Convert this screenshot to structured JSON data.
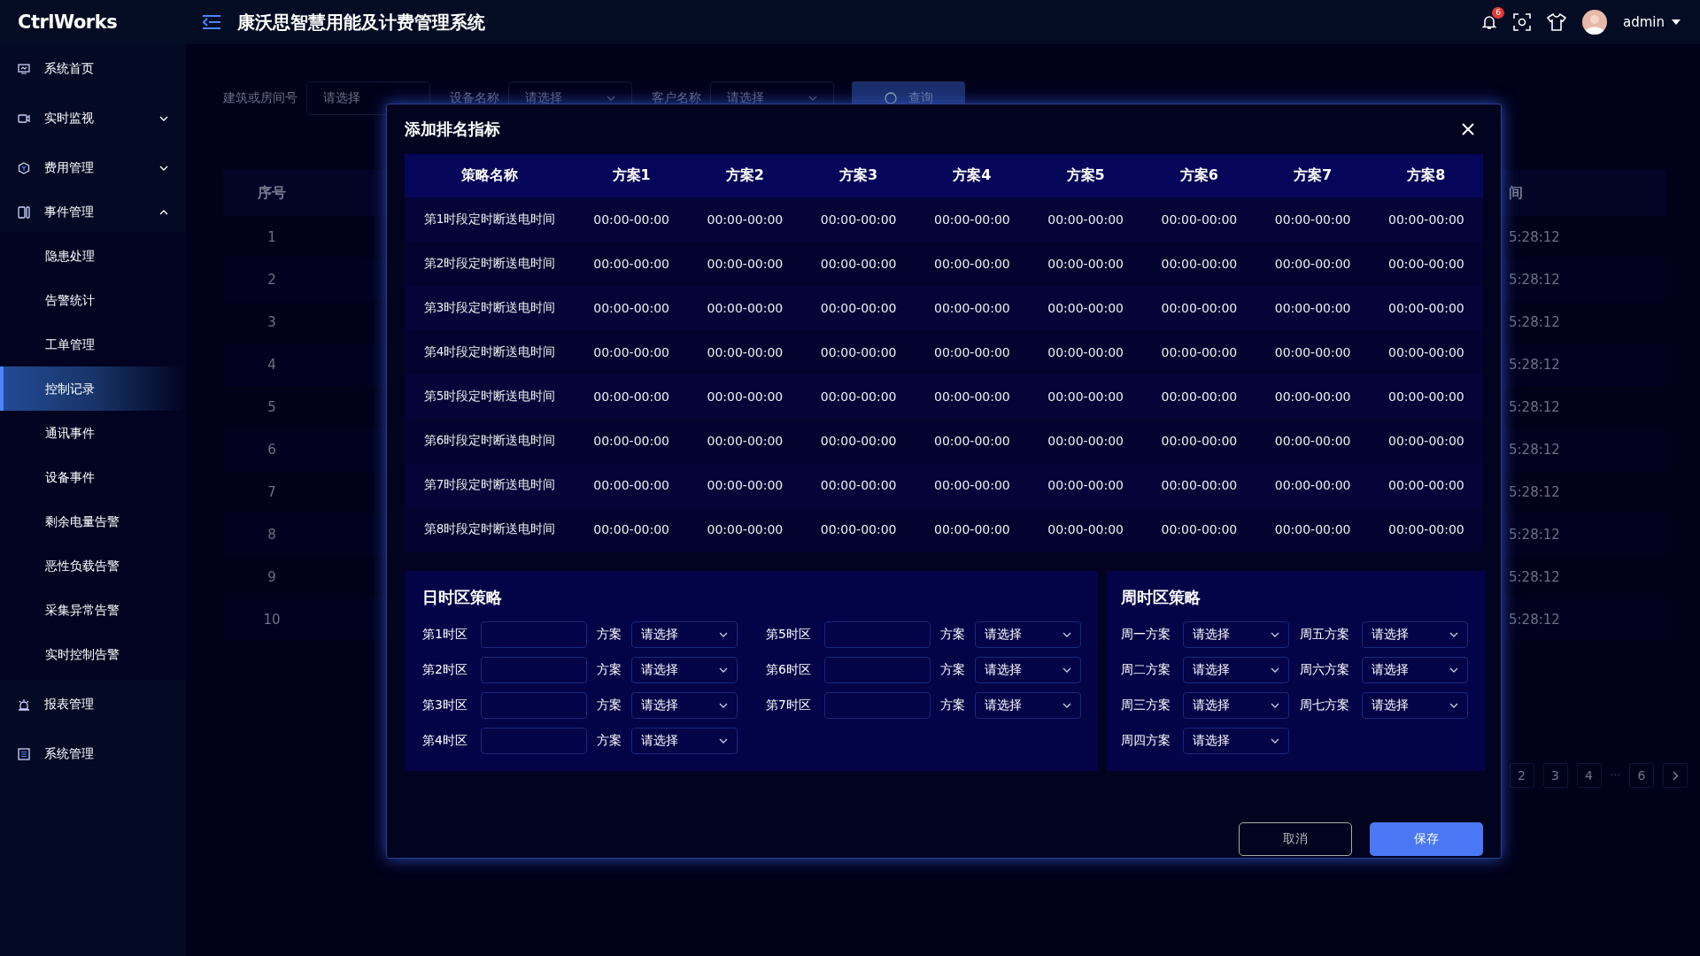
{
  "app": {
    "logo": "CtrlWorks",
    "title": "康沃思智慧用能及计费管理系统",
    "notification_count": "6",
    "user": "admin"
  },
  "sidebar": {
    "items": [
      {
        "label": "系统首页",
        "selected": false
      },
      {
        "label": "实时监视",
        "selected": false,
        "expanded": false
      },
      {
        "label": "费用管理",
        "selected": false,
        "expanded": false
      },
      {
        "label": "事件管理",
        "selected": false,
        "expanded": true,
        "children": [
          {
            "label": "隐患处理",
            "selected": false
          },
          {
            "label": "告警统计",
            "selected": false
          },
          {
            "label": "工单管理",
            "selected": false
          },
          {
            "label": "控制记录",
            "selected": true
          },
          {
            "label": "通讯事件",
            "selected": false
          },
          {
            "label": "设备事件",
            "selected": false
          },
          {
            "label": "剩余电量告警",
            "selected": false
          },
          {
            "label": "恶性负载告警",
            "selected": false
          },
          {
            "label": "采集异常告警",
            "selected": false
          },
          {
            "label": "实时控制告警",
            "selected": false
          }
        ]
      },
      {
        "label": "报表管理",
        "selected": false
      },
      {
        "label": "系统管理",
        "selected": false
      }
    ]
  },
  "filters": [
    {
      "label": "建筑或房间号",
      "placeholder": "请选择",
      "kind": "input"
    },
    {
      "label": "设备名称",
      "placeholder": "请选择",
      "kind": "select"
    },
    {
      "label": "客户名称",
      "placeholder": "请选择",
      "kind": "select"
    }
  ],
  "search_button": "查询",
  "table": {
    "columns": [
      "序号",
      "间"
    ],
    "rows": [
      {
        "index": "1",
        "time": "5:28:12"
      },
      {
        "index": "2",
        "time": "5:28:12"
      },
      {
        "index": "3",
        "time": "5:28:12"
      },
      {
        "index": "4",
        "time": "5:28:12"
      },
      {
        "index": "5",
        "time": "5:28:12"
      },
      {
        "index": "6",
        "time": "5:28:12"
      },
      {
        "index": "7",
        "time": "5:28:12"
      },
      {
        "index": "8",
        "time": "5:28:12"
      },
      {
        "index": "9",
        "time": "5:28:12"
      },
      {
        "index": "10",
        "time": "5:28:12"
      }
    ]
  },
  "pagination": {
    "pages": [
      "2",
      "3",
      "4",
      "···",
      "6"
    ]
  },
  "dialog": {
    "title": "添加排名指标",
    "columns": [
      "策略名称",
      "方案1",
      "方案2",
      "方案3",
      "方案4",
      "方案5",
      "方案6",
      "方案7",
      "方案8"
    ],
    "rows": [
      {
        "name": "第1时段定时断送电时间",
        "values": [
          "00:00-00:00",
          "00:00-00:00",
          "00:00-00:00",
          "00:00-00:00",
          "00:00-00:00",
          "00:00-00:00",
          "00:00-00:00",
          "00:00-00:00"
        ]
      },
      {
        "name": "第2时段定时断送电时间",
        "values": [
          "00:00-00:00",
          "00:00-00:00",
          "00:00-00:00",
          "00:00-00:00",
          "00:00-00:00",
          "00:00-00:00",
          "00:00-00:00",
          "00:00-00:00"
        ]
      },
      {
        "name": "第3时段定时断送电时间",
        "values": [
          "00:00-00:00",
          "00:00-00:00",
          "00:00-00:00",
          "00:00-00:00",
          "00:00-00:00",
          "00:00-00:00",
          "00:00-00:00",
          "00:00-00:00"
        ]
      },
      {
        "name": "第4时段定时断送电时间",
        "values": [
          "00:00-00:00",
          "00:00-00:00",
          "00:00-00:00",
          "00:00-00:00",
          "00:00-00:00",
          "00:00-00:00",
          "00:00-00:00",
          "00:00-00:00"
        ]
      },
      {
        "name": "第5时段定时断送电时间",
        "values": [
          "00:00-00:00",
          "00:00-00:00",
          "00:00-00:00",
          "00:00-00:00",
          "00:00-00:00",
          "00:00-00:00",
          "00:00-00:00",
          "00:00-00:00"
        ]
      },
      {
        "name": "第6时段定时断送电时间",
        "values": [
          "00:00-00:00",
          "00:00-00:00",
          "00:00-00:00",
          "00:00-00:00",
          "00:00-00:00",
          "00:00-00:00",
          "00:00-00:00",
          "00:00-00:00"
        ]
      },
      {
        "name": "第7时段定时断送电时间",
        "values": [
          "00:00-00:00",
          "00:00-00:00",
          "00:00-00:00",
          "00:00-00:00",
          "00:00-00:00",
          "00:00-00:00",
          "00:00-00:00",
          "00:00-00:00"
        ]
      },
      {
        "name": "第8时段定时断送电时间",
        "values": [
          "00:00-00:00",
          "00:00-00:00",
          "00:00-00:00",
          "00:00-00:00",
          "00:00-00:00",
          "00:00-00:00",
          "00:00-00:00",
          "00:00-00:00"
        ]
      }
    ],
    "day_strategy": {
      "title": "日时区策略",
      "zones": [
        {
          "label": "第1时区",
          "plan_label": "方案",
          "placeholder": "请选择"
        },
        {
          "label": "第2时区",
          "plan_label": "方案",
          "placeholder": "请选择"
        },
        {
          "label": "第3时区",
          "plan_label": "方案",
          "placeholder": "请选择"
        },
        {
          "label": "第4时区",
          "plan_label": "方案",
          "placeholder": "请选择"
        },
        {
          "label": "第5时区",
          "plan_label": "方案",
          "placeholder": "请选择"
        },
        {
          "label": "第6时区",
          "plan_label": "方案",
          "placeholder": "请选择"
        },
        {
          "label": "第7时区",
          "plan_label": "方案",
          "placeholder": "请选择"
        }
      ]
    },
    "week_strategy": {
      "title": "周时区策略",
      "days": [
        {
          "label": "周一方案",
          "placeholder": "请选择"
        },
        {
          "label": "周二方案",
          "placeholder": "请选择"
        },
        {
          "label": "周三方案",
          "placeholder": "请选择"
        },
        {
          "label": "周四方案",
          "placeholder": "请选择"
        },
        {
          "label": "周五方案",
          "placeholder": "请选择"
        },
        {
          "label": "周六方案",
          "placeholder": "请选择"
        },
        {
          "label": "周七方案",
          "placeholder": "请选择"
        }
      ]
    },
    "cancel_button": "取消",
    "save_button": "保存"
  }
}
